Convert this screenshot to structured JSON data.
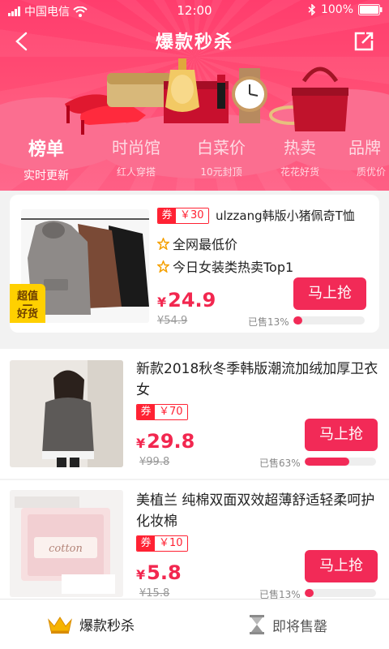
{
  "status_bar": {
    "carrier": "中国电信",
    "time": "12:00",
    "battery": "100%"
  },
  "nav": {
    "title": "爆款秒杀",
    "back_icon": "back-arrow-icon",
    "share_icon": "share-icon"
  },
  "tabs": [
    {
      "label": "榜单",
      "sub": "实时更新",
      "active": true
    },
    {
      "label": "时尚馆",
      "sub": "红人穿搭",
      "active": false
    },
    {
      "label": "白菜价",
      "sub": "10元封顶",
      "active": false
    },
    {
      "label": "热卖",
      "sub": "花花好货",
      "active": false
    },
    {
      "label": "品牌",
      "sub": "质优价",
      "active": false
    }
  ],
  "featured": {
    "coupon_tag": "券",
    "coupon_value": "￥30",
    "title": "ulzzang韩版小猪佩奇T恤",
    "features": [
      "全网最低价",
      "今日女装类热卖Top1"
    ],
    "badge_line1": "超值",
    "badge_line2": "好货",
    "currency": "¥",
    "price": "24.9",
    "original_price": "¥54.9",
    "sold_text": "已售13%",
    "sold_ratio": 0.13,
    "buy_label": "马上抢"
  },
  "items": [
    {
      "title": "新款2018秋冬季韩版潮流加绒加厚卫衣女",
      "coupon_tag": "券",
      "coupon_value": "￥70",
      "currency": "¥",
      "price": "29.8",
      "original_price": "¥99.8",
      "sold_text": "已售63%",
      "sold_ratio": 0.63,
      "buy_label": "马上抢"
    },
    {
      "title": "美植兰 纯棉双面双效超薄舒适轻柔呵护化妆棉",
      "coupon_tag": "券",
      "coupon_value": "￥10",
      "currency": "¥",
      "price": "5.8",
      "original_price": "¥15.8",
      "sold_text": "已售13%",
      "sold_ratio": 0.13,
      "buy_label": "马上抢"
    }
  ],
  "bottom_bar": [
    {
      "label": "爆款秒杀",
      "icon": "crown-icon",
      "active": true
    },
    {
      "label": "即将售罄",
      "icon": "hourglass-icon",
      "active": false
    }
  ],
  "colors": {
    "accent": "#f22a57",
    "header": "#ff4d74",
    "coupon": "#ff2233",
    "badge": "#ffd000"
  },
  "product_thumb": {
    "cotton_pad_label": "cotton"
  }
}
